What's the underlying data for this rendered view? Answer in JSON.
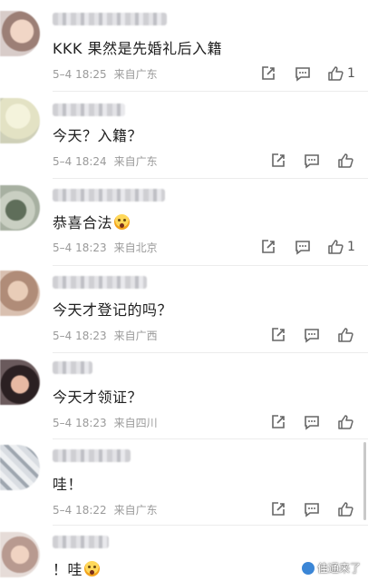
{
  "comments": [
    {
      "text": "KKK 果然是先婚礼后入籍",
      "date": "5–4 18:25",
      "location": "来自广东",
      "likes": "1",
      "emoji": false
    },
    {
      "text": "今天？入籍？",
      "date": "5–4 18:24",
      "location": "来自广东",
      "likes": "",
      "emoji": false
    },
    {
      "text": "恭喜合法",
      "date": "5–4 18:23",
      "location": "来自北京",
      "likes": "1",
      "emoji": true
    },
    {
      "text": "今天才登记的吗？",
      "date": "5–4 18:23",
      "location": "来自广西",
      "likes": "",
      "emoji": false
    },
    {
      "text": "今天才领证？",
      "date": "5–4 18:23",
      "location": "来自四川",
      "likes": "",
      "emoji": false
    },
    {
      "text": "哇！",
      "date": "5–4 18:22",
      "location": "来自广东",
      "likes": "",
      "emoji": false
    },
    {
      "text": "！哇",
      "date": "",
      "location": "",
      "likes": "",
      "emoji": true
    }
  ],
  "icons": {
    "share": "share-icon",
    "comment": "comment-icon",
    "like": "like-icon"
  },
  "watermark": {
    "text": "佳通来了"
  }
}
